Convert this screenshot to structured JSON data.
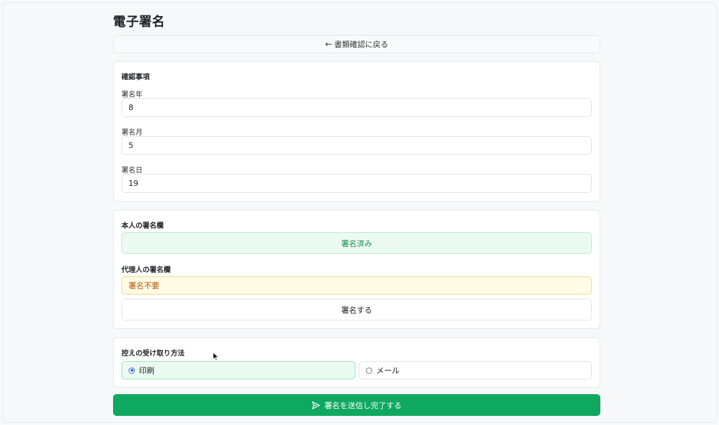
{
  "page": {
    "title": "電子署名"
  },
  "back_button": {
    "arrow": "←",
    "label": "書類確認に戻る"
  },
  "confirm_section": {
    "title": "確認事項",
    "fields": [
      {
        "label": "署名年",
        "value": "8"
      },
      {
        "label": "署名月",
        "value": "5"
      },
      {
        "label": "署名日",
        "value": "19"
      }
    ]
  },
  "signature_section": {
    "principal_label": "本人の署名欄",
    "principal_status": "署名済み",
    "agent_label": "代理人の署名欄",
    "agent_status": "署名不要",
    "sign_button": "署名する"
  },
  "copy_section": {
    "title": "控えの受け取り方法",
    "options": [
      {
        "label": "印刷",
        "selected": true
      },
      {
        "label": "メール",
        "selected": false
      }
    ]
  },
  "submit_button": {
    "label": "署名を送信し完了する",
    "icon": "send-icon"
  },
  "colors": {
    "accent": "#0fa860",
    "signed_bg": "#ecfbf2",
    "warning_bg": "#fffbe6",
    "radio": "#2b6fd6"
  }
}
